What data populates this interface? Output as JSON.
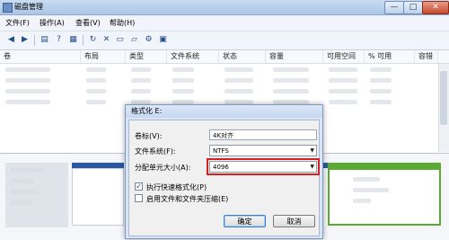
{
  "window": {
    "title": "磁盘管理"
  },
  "menu": [
    "文件(F)",
    "操作(A)",
    "查看(V)",
    "帮助(H)"
  ],
  "toolbar_icons": [
    "back-icon",
    "forward-icon",
    "list-icon",
    "help-icon",
    "properties-icon",
    "refresh-icon",
    "delete-icon",
    "open-icon",
    "explore-icon",
    "settings-icon"
  ],
  "columns": [
    "卷",
    "布局",
    "类型",
    "文件系统",
    "状态",
    "容量",
    "可用空间",
    "% 可用",
    "容错"
  ],
  "dialog": {
    "title": "格式化 E:",
    "volume_label_label": "卷标(V):",
    "volume_label_value": "4K对齐",
    "filesystem_label": "文件系统(F):",
    "filesystem_value": "NTFS",
    "alloc_label": "分配单元大小(A):",
    "alloc_value": "4096",
    "quick_format_label": "执行快速格式化(P)",
    "quick_format_checked": true,
    "compression_label": "启用文件和文件夹压缩(E)",
    "compression_checked": false,
    "ok_label": "确定",
    "cancel_label": "取消"
  },
  "window_controls": {
    "minimize": "—",
    "maximize": "□",
    "close": "✕"
  },
  "colors": {
    "highlight": "#d62020",
    "partition": "#2a58a6",
    "selected_partition": "#5caa36"
  }
}
